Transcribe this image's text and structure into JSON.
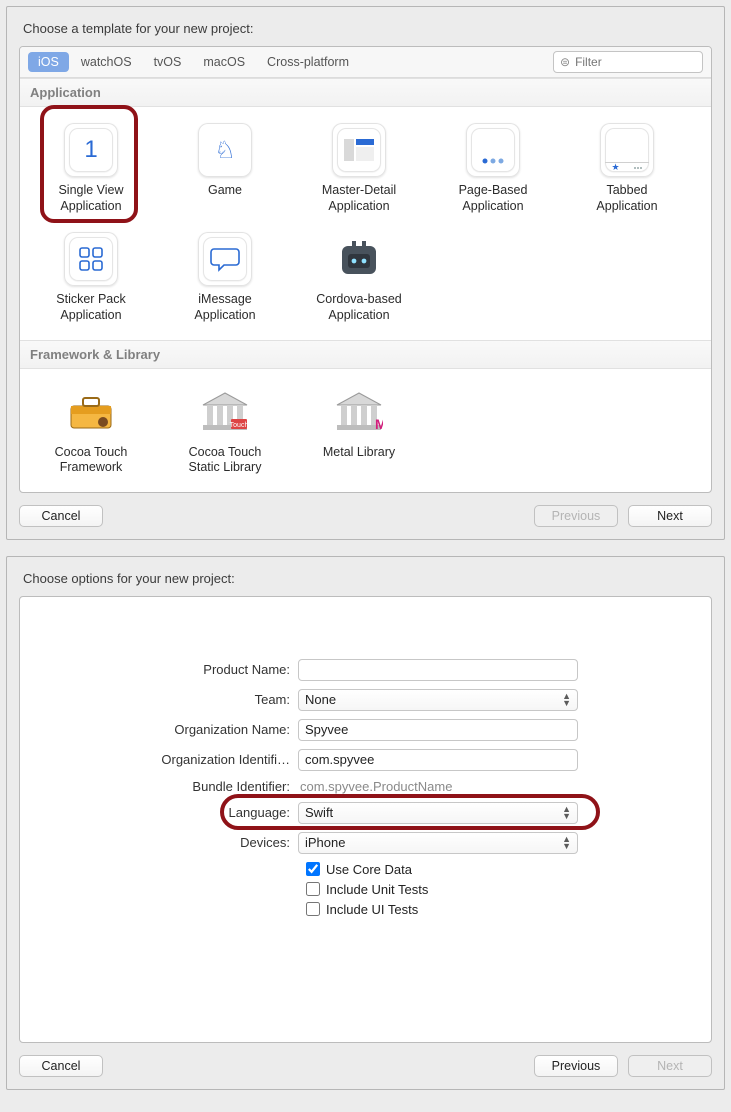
{
  "template_panel": {
    "title": "Choose a template for your new project:",
    "tabs": [
      "iOS",
      "watchOS",
      "tvOS",
      "macOS",
      "Cross-platform"
    ],
    "active_tab": 0,
    "filter_placeholder": "Filter",
    "sections": {
      "application": {
        "header": "Application",
        "items": [
          {
            "id": "single-view",
            "label": "Single View\nApplication"
          },
          {
            "id": "game",
            "label": "Game"
          },
          {
            "id": "master-detail",
            "label": "Master-Detail\nApplication"
          },
          {
            "id": "page-based",
            "label": "Page-Based\nApplication"
          },
          {
            "id": "tabbed",
            "label": "Tabbed\nApplication"
          },
          {
            "id": "sticker-pack",
            "label": "Sticker Pack\nApplication"
          },
          {
            "id": "imessage",
            "label": "iMessage\nApplication"
          },
          {
            "id": "cordova",
            "label": "Cordova-based\nApplication"
          }
        ]
      },
      "framework": {
        "header": "Framework & Library",
        "items": [
          {
            "id": "cocoa-touch-framework",
            "label": "Cocoa Touch\nFramework"
          },
          {
            "id": "cocoa-touch-static",
            "label": "Cocoa Touch\nStatic Library"
          },
          {
            "id": "metal",
            "label": "Metal Library"
          }
        ]
      }
    },
    "buttons": {
      "cancel": "Cancel",
      "previous": "Previous",
      "next": "Next"
    }
  },
  "options_panel": {
    "title": "Choose options for your new project:",
    "fields": {
      "product_name": {
        "label": "Product Name:",
        "value": ""
      },
      "team": {
        "label": "Team:",
        "value": "None"
      },
      "org_name": {
        "label": "Organization Name:",
        "value": "Spyvee"
      },
      "org_id": {
        "label": "Organization Identifi…",
        "value": "com.spyvee"
      },
      "bundle_id": {
        "label": "Bundle Identifier:",
        "value": "com.spyvee.ProductName"
      },
      "language": {
        "label": "Language:",
        "value": "Swift"
      },
      "devices": {
        "label": "Devices:",
        "value": "iPhone"
      }
    },
    "checkboxes": {
      "core_data": {
        "label": "Use Core Data",
        "checked": true
      },
      "unit_tests": {
        "label": "Include Unit Tests",
        "checked": false
      },
      "ui_tests": {
        "label": "Include UI Tests",
        "checked": false
      }
    },
    "buttons": {
      "cancel": "Cancel",
      "previous": "Previous",
      "next": "Next"
    }
  },
  "highlights": {
    "selected_template": "single-view",
    "highlighted_field": "language"
  }
}
